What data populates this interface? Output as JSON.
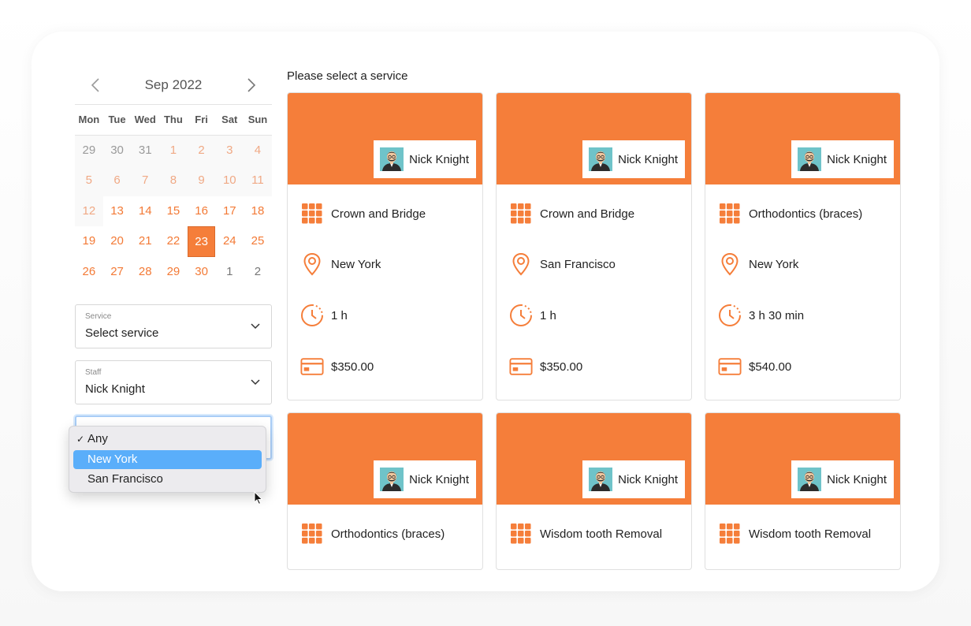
{
  "colors": {
    "accent": "#f57e3a",
    "highlight": "#5aaefa"
  },
  "calendar": {
    "month_label": "Sep 2022",
    "prev_icon": "chevron-left-icon",
    "next_icon": "chevron-right-icon",
    "weekdays": [
      "Mon",
      "Tue",
      "Wed",
      "Thu",
      "Fri",
      "Sat",
      "Sun"
    ],
    "weeks": [
      [
        {
          "d": "29",
          "s": "prev"
        },
        {
          "d": "30",
          "s": "prev"
        },
        {
          "d": "31",
          "s": "prev"
        },
        {
          "d": "1",
          "s": "past"
        },
        {
          "d": "2",
          "s": "past"
        },
        {
          "d": "3",
          "s": "past"
        },
        {
          "d": "4",
          "s": "past"
        }
      ],
      [
        {
          "d": "5",
          "s": "past"
        },
        {
          "d": "6",
          "s": "past"
        },
        {
          "d": "7",
          "s": "past"
        },
        {
          "d": "8",
          "s": "past"
        },
        {
          "d": "9",
          "s": "past"
        },
        {
          "d": "10",
          "s": "past"
        },
        {
          "d": "11",
          "s": "past"
        }
      ],
      [
        {
          "d": "12",
          "s": "past"
        },
        {
          "d": "13",
          "s": "avail"
        },
        {
          "d": "14",
          "s": "avail"
        },
        {
          "d": "15",
          "s": "avail"
        },
        {
          "d": "16",
          "s": "avail"
        },
        {
          "d": "17",
          "s": "avail"
        },
        {
          "d": "18",
          "s": "avail"
        }
      ],
      [
        {
          "d": "19",
          "s": "avail"
        },
        {
          "d": "20",
          "s": "avail"
        },
        {
          "d": "21",
          "s": "avail"
        },
        {
          "d": "22",
          "s": "avail"
        },
        {
          "d": "23",
          "s": "sel"
        },
        {
          "d": "24",
          "s": "avail"
        },
        {
          "d": "25",
          "s": "avail"
        }
      ],
      [
        {
          "d": "26",
          "s": "avail"
        },
        {
          "d": "27",
          "s": "avail"
        },
        {
          "d": "28",
          "s": "avail"
        },
        {
          "d": "29",
          "s": "avail"
        },
        {
          "d": "30",
          "s": "avail"
        },
        {
          "d": "1",
          "s": "next"
        },
        {
          "d": "2",
          "s": "next"
        }
      ]
    ]
  },
  "filters": {
    "service": {
      "label": "Service",
      "value": "Select service"
    },
    "staff": {
      "label": "Staff",
      "value": "Nick Knight"
    },
    "location": {
      "options": [
        {
          "label": "Any",
          "checked": true,
          "highlighted": false
        },
        {
          "label": "New York",
          "checked": false,
          "highlighted": true
        },
        {
          "label": "San Francisco",
          "checked": false,
          "highlighted": false
        }
      ]
    }
  },
  "services": {
    "heading": "Please select a service",
    "cards": [
      {
        "staff": "Nick Knight",
        "service": "Crown and Bridge",
        "location": "New York",
        "duration": "1 h",
        "price": "$350.00"
      },
      {
        "staff": "Nick Knight",
        "service": "Crown and Bridge",
        "location": "San Francisco",
        "duration": "1 h",
        "price": "$350.00"
      },
      {
        "staff": "Nick Knight",
        "service": "Orthodontics (braces)",
        "location": "New York",
        "duration": "3 h 30 min",
        "price": "$540.00"
      },
      {
        "staff": "Nick Knight",
        "service": "Orthodontics (braces)"
      },
      {
        "staff": "Nick Knight",
        "service": "Wisdom tooth Removal"
      },
      {
        "staff": "Nick Knight",
        "service": "Wisdom tooth Removal"
      }
    ]
  }
}
